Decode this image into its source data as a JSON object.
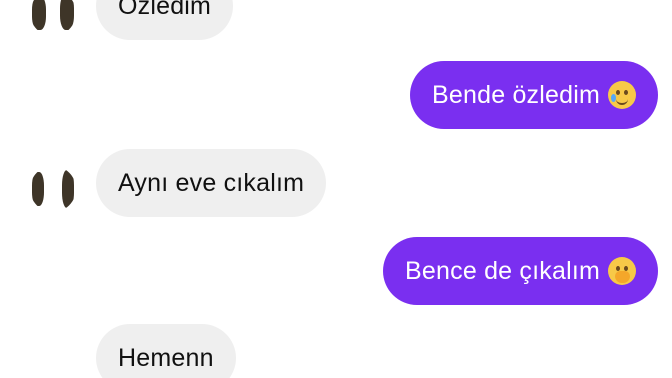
{
  "messages": [
    {
      "side": "in",
      "text": "Özledim"
    },
    {
      "side": "out",
      "text": "Bende özledim",
      "emoji": "face-holding-back-tears"
    },
    {
      "side": "in",
      "text": "Aynı eve cıkalım"
    },
    {
      "side": "out",
      "text": "Bence de çıkalım",
      "emoji": "face-with-hand-over-mouth"
    },
    {
      "side": "in",
      "text": "Hemenn"
    }
  ],
  "colors": {
    "incoming_bubble": "#efefef",
    "outgoing_bubble": "#7a2ff0",
    "incoming_text": "#111111",
    "outgoing_text": "#ffffff"
  }
}
